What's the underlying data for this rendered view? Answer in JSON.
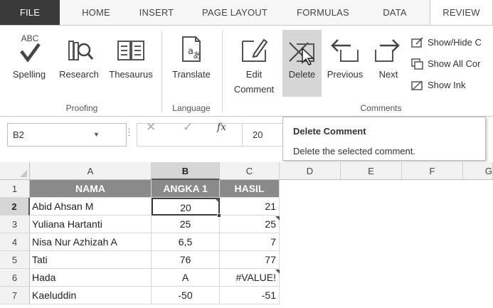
{
  "tabs": [
    {
      "label": "FILE"
    },
    {
      "label": "HOME"
    },
    {
      "label": "INSERT"
    },
    {
      "label": "PAGE LAYOUT"
    },
    {
      "label": "FORMULAS"
    },
    {
      "label": "DATA"
    },
    {
      "label": "REVIEW"
    }
  ],
  "ribbon": {
    "proofing": {
      "group_label": "Proofing",
      "spelling": "Spelling",
      "spelling_icon_text": "ABC",
      "research": "Research",
      "thesaurus": "Thesaurus"
    },
    "language": {
      "group_label": "Language",
      "translate": "Translate"
    },
    "comments": {
      "group_label": "Comments",
      "edit_comment_line1": "Edit",
      "edit_comment_line2": "Comment",
      "delete": "Delete",
      "previous": "Previous",
      "next": "Next",
      "show_hide": "Show/Hide C",
      "show_all": "Show All Cor",
      "show_ink": "Show Ink"
    }
  },
  "formula_bar": {
    "name_box": "B2",
    "fx": "fx",
    "cancel_glyph": "✕",
    "enter_glyph": "✓",
    "value": "20"
  },
  "tooltip": {
    "title": "Delete Comment",
    "description": "Delete the selected comment."
  },
  "sheet": {
    "columns": [
      "A",
      "B",
      "C",
      "D",
      "E",
      "F",
      "G"
    ],
    "rows": [
      "1",
      "2",
      "3",
      "4",
      "5",
      "6",
      "7"
    ],
    "header_row": [
      "NAMA",
      "ANGKA 1",
      "HASIL"
    ],
    "data_rows": [
      [
        "Abid Ahsan M",
        "20",
        "21"
      ],
      [
        "Yuliana Hartanti",
        "25",
        "25"
      ],
      [
        "Nisa Nur Azhizah A",
        "6,5",
        "7"
      ],
      [
        "Tati",
        "76",
        "77"
      ],
      [
        "Hada",
        "A",
        "#VALUE!"
      ],
      [
        "Kaeluddin",
        "-50",
        "-51"
      ]
    ],
    "active_cell": "B2"
  }
}
